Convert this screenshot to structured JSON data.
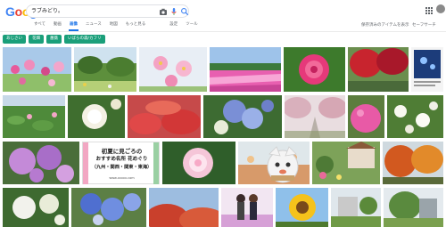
{
  "header": {
    "logo": [
      "G",
      "o",
      "o",
      "g",
      "l",
      "e"
    ],
    "logo_colors": [
      "#4285f4",
      "#ea4335",
      "#fbbc05",
      "#4285f4",
      "#34a853",
      "#ea4335"
    ],
    "search_value": "ラブみどり。"
  },
  "tabs": [
    {
      "label": "すべて",
      "active": false
    },
    {
      "label": "動画",
      "active": false
    },
    {
      "label": "画像",
      "active": true
    },
    {
      "label": "ニュース",
      "active": false
    },
    {
      "label": "地図",
      "active": false
    },
    {
      "label": "もっと見る",
      "active": false
    },
    {
      "label": "設定",
      "active": false
    },
    {
      "label": "ツール",
      "active": false
    }
  ],
  "tabs_right": [
    "保存済みのアイテムを表示",
    "セーフサーチ"
  ],
  "chips": [
    "あじさい",
    "花畑",
    "薔薇",
    "いばらの森/カフリ"
  ],
  "tiles": {
    "poster_title": "初夏に見ごろの",
    "poster_line2": "おすすめ名所 花めぐり",
    "poster_line3": "（九州・関西・関東・東海）",
    "poster_url": "www.xxxxx.com"
  },
  "colors": {
    "accent": "#1a73e8",
    "chip": "#1a9f7a"
  }
}
